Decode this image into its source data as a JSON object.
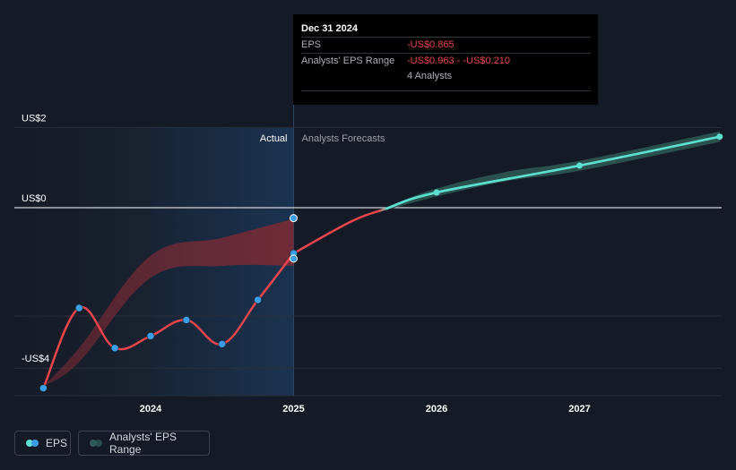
{
  "colors": {
    "background": "#151b26",
    "actual_line": "#e8454d",
    "forecast_line": "#5ee0d0",
    "range_fill": "#7a2a35",
    "forecast_range_fill": "#2f5a57",
    "point": "#3a9ee8",
    "zero_line": "#ffffff",
    "grid": "#2a303b"
  },
  "tooltip": {
    "date": "Dec 31 2024",
    "rows": [
      {
        "key": "EPS",
        "value": "-US$0.865"
      },
      {
        "key": "Analysts' EPS Range",
        "value": "-US$0.963 - -US$0.210"
      },
      {
        "key": "",
        "value": "4 Analysts"
      }
    ]
  },
  "legend": {
    "eps_label": "EPS",
    "range_label": "Analysts' EPS Range"
  },
  "chart_data": {
    "type": "line",
    "x_range": [
      2023.1,
      2027.98
    ],
    "ylim": [
      -4.45,
      2.1
    ],
    "y_ticks": [
      {
        "value": 2,
        "label": "US$2"
      },
      {
        "value": 0,
        "label": "US$0"
      },
      {
        "value": -4,
        "label": "-US$4"
      }
    ],
    "x_ticks": [
      {
        "value": 2024,
        "label": "2024"
      },
      {
        "value": 2025,
        "label": "2025"
      },
      {
        "value": 2026,
        "label": "2026"
      },
      {
        "value": 2027,
        "label": "2027"
      }
    ],
    "divider_x": 2025.0,
    "highlight_start": 2024.0,
    "region_labels": {
      "actual": "Actual",
      "forecast": "Analysts Forecasts"
    },
    "series": [
      {
        "name": "EPS",
        "kind": "actual",
        "points": [
          {
            "x": 2023.25,
            "y": -4.5
          },
          {
            "x": 2023.5,
            "y": -2.5
          },
          {
            "x": 2023.75,
            "y": -3.5
          },
          {
            "x": 2024.0,
            "y": -3.2
          },
          {
            "x": 2024.25,
            "y": -2.8
          },
          {
            "x": 2024.5,
            "y": -3.4
          },
          {
            "x": 2024.75,
            "y": -2.3
          },
          {
            "x": 2025.0,
            "y": -1.14
          }
        ]
      },
      {
        "name": "EPS",
        "kind": "forecast",
        "points": [
          {
            "x": 2025.0,
            "y": -1.14
          },
          {
            "x": 2025.4,
            "y": -0.35
          },
          {
            "x": 2025.65,
            "y": -0.02
          },
          {
            "x": 2026.0,
            "y": 0.38
          },
          {
            "x": 2027.0,
            "y": 1.05
          },
          {
            "x": 2027.98,
            "y": 1.77
          }
        ]
      }
    ],
    "range_band": {
      "name": "Analysts' EPS Range",
      "x": [
        2023.25,
        2023.5,
        2024.0,
        2024.5,
        2025.0
      ],
      "upper": [
        -4.45,
        -3.5,
        -1.2,
        -0.75,
        -0.28
      ],
      "lower": [
        -4.45,
        -3.85,
        -1.75,
        -1.45,
        -1.45
      ]
    },
    "forecast_band": {
      "x": [
        2025.65,
        2026.0,
        2026.5,
        2027.0,
        2027.98
      ],
      "upper": [
        0.02,
        0.48,
        0.9,
        1.17,
        1.9
      ],
      "lower": [
        -0.06,
        0.28,
        0.67,
        0.92,
        1.64
      ]
    },
    "extra_points": [
      {
        "x": 2025.0,
        "y": -0.26
      },
      {
        "x": 2025.0,
        "y": -1.27
      },
      {
        "x": 2026.0,
        "y": 0.38,
        "series": "forecast"
      },
      {
        "x": 2027.0,
        "y": 1.05,
        "series": "forecast"
      },
      {
        "x": 2027.98,
        "y": 1.77,
        "series": "forecast"
      }
    ]
  }
}
